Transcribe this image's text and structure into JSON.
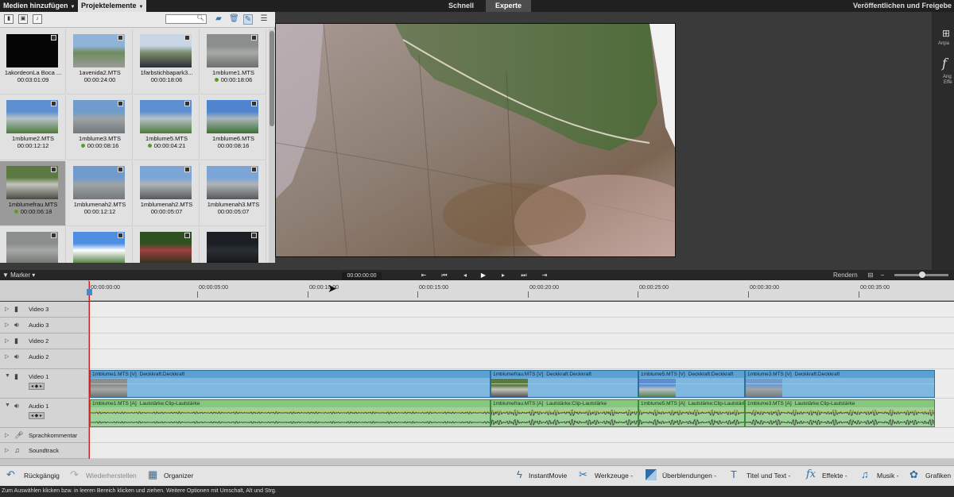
{
  "menu": {
    "media_add": "Medien hinzufügen",
    "project_elements": "Projektelemente"
  },
  "tabs": {
    "quick": "Schnell",
    "expert": "Experte"
  },
  "publish": "Veröffentlichen und Freigebe",
  "media": [
    {
      "name": "1akordeonLa Boca ...",
      "duration": "00:03:01:09",
      "dot": false,
      "thumb": "black"
    },
    {
      "name": "1avenida2.MTS",
      "duration": "00:00:24:00",
      "dot": false,
      "thumb": "street"
    },
    {
      "name": "1farbstichbapark3...",
      "duration": "00:00:18:06",
      "dot": false,
      "thumb": "park"
    },
    {
      "name": "1mblume1.MTS",
      "duration": "00:00:18:06",
      "dot": true,
      "thumb": "metal"
    },
    {
      "name": "1mblume2.MTS",
      "duration": "00:00:12:12",
      "dot": false,
      "thumb": "flower"
    },
    {
      "name": "1mblume3.MTS",
      "duration": "00:00:08:16",
      "dot": true,
      "thumb": "petal"
    },
    {
      "name": "1mblume5.MTS",
      "duration": "00:00:04:21",
      "dot": true,
      "thumb": "flower"
    },
    {
      "name": "1mblume6.MTS",
      "duration": "00:00:08:16",
      "dot": false,
      "thumb": "flower2"
    },
    {
      "name": "1mblumefrau.MTS",
      "duration": "00:00:06:18",
      "dot": true,
      "thumb": "closeup",
      "selected": true
    },
    {
      "name": "1mblumenah2.MTS",
      "duration": "00:00:12:12",
      "dot": false,
      "thumb": "petal"
    },
    {
      "name": "1mblumenah2.MTS",
      "duration": "00:00:05:07",
      "dot": false,
      "thumb": "petal2"
    },
    {
      "name": "1mblumenah3.MTS",
      "duration": "00:00:05:07",
      "dot": false,
      "thumb": "petal2"
    },
    {
      "name": "",
      "duration": "",
      "dot": false,
      "thumb": "metal"
    },
    {
      "name": "",
      "duration": "",
      "dot": false,
      "thumb": "sky"
    },
    {
      "name": "",
      "duration": "",
      "dot": false,
      "thumb": "trees"
    },
    {
      "name": "",
      "duration": "",
      "dot": false,
      "thumb": "dark"
    }
  ],
  "right_panel": {
    "adjust": "Anpa",
    "effects_a": "Ang",
    "effects_b": "Effe"
  },
  "transport": {
    "marker": "Marker",
    "timecode": "00:00:00:00",
    "render": "Rendern"
  },
  "ruler": [
    "00:00:00:00",
    "00:00:05:00",
    "00:00:10:00",
    "00:00:15:00",
    "00:00:20:00",
    "00:00:25:00",
    "00:00:30:00",
    "00:00:35:00"
  ],
  "tracks": [
    "Video 3",
    "Audio 3",
    "Video 2",
    "Audio 2",
    "Video 1",
    "Audio 1",
    "Sprachkommentar",
    "Soundtrack"
  ],
  "video_clips": [
    {
      "name": "1mblume1.MTS [V]",
      "fx": "Deckkraft:Deckkraft",
      "thumb": "metal"
    },
    {
      "name": "1mblumefrau.MTS [V]",
      "fx": "Deckkraft:Deckkraft",
      "thumb": "closeup"
    },
    {
      "name": "1mblume5.MTS [V]",
      "fx": "Deckkraft:Deckkraft",
      "thumb": "flower"
    },
    {
      "name": "1mblume3.MTS [V]",
      "fx": "Deckkraft:Deckkraft",
      "thumb": "petal"
    }
  ],
  "audio_clips": [
    {
      "name": "1mblume1.MTS [A]",
      "fx": "Lautstärke:Clip-Lautstärke"
    },
    {
      "name": "1mblumefrau.MTS [A]",
      "fx": "Lautstärke:Clip-Lautstärke"
    },
    {
      "name": "1mblume5.MTS [A]",
      "fx": "Lautstärke:Clip-Lautstärke"
    },
    {
      "name": "1mblume3.MTS [A]",
      "fx": "Lautstärke:Clip-Lautstärke"
    }
  ],
  "bottom": {
    "undo": "Rückgängig",
    "redo": "Wiederherstellen",
    "organizer": "Organizer",
    "instant_movie": "InstantMovie",
    "tools": "Werkzeuge",
    "transitions": "Überblendungen",
    "titles": "Titel und Text",
    "effects": "Effekte",
    "music": "Musik",
    "graphics": "Grafiken"
  },
  "status": "Zum Auswählen klicken bzw. in leeren Bereich klicken und ziehen. Weitere Optionen mit Umschalt, Alt und Strg."
}
